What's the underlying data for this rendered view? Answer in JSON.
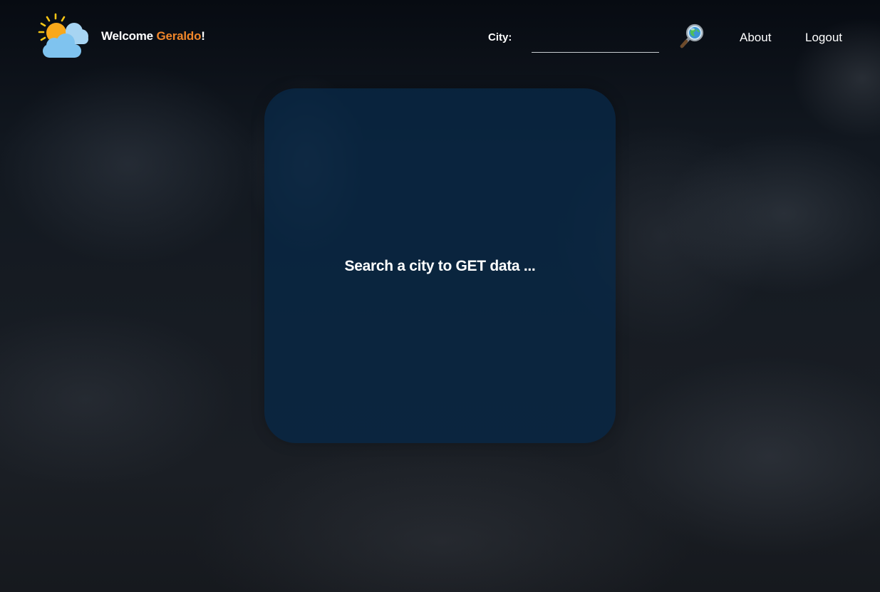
{
  "header": {
    "welcome_prefix": "Welcome ",
    "username": "Geraldo",
    "welcome_suffix": "!",
    "logo_icon": "sun-behind-cloud-icon",
    "city_label": "City:",
    "city_value": "",
    "search_icon": "magnifying-glass-globe-icon",
    "nav": {
      "about": "About",
      "logout": "Logout"
    }
  },
  "main": {
    "message": "Search a city to GET data ..."
  },
  "colors": {
    "username_accent": "#f0862a",
    "card_background": "#08283f",
    "text": "#ffffff"
  }
}
